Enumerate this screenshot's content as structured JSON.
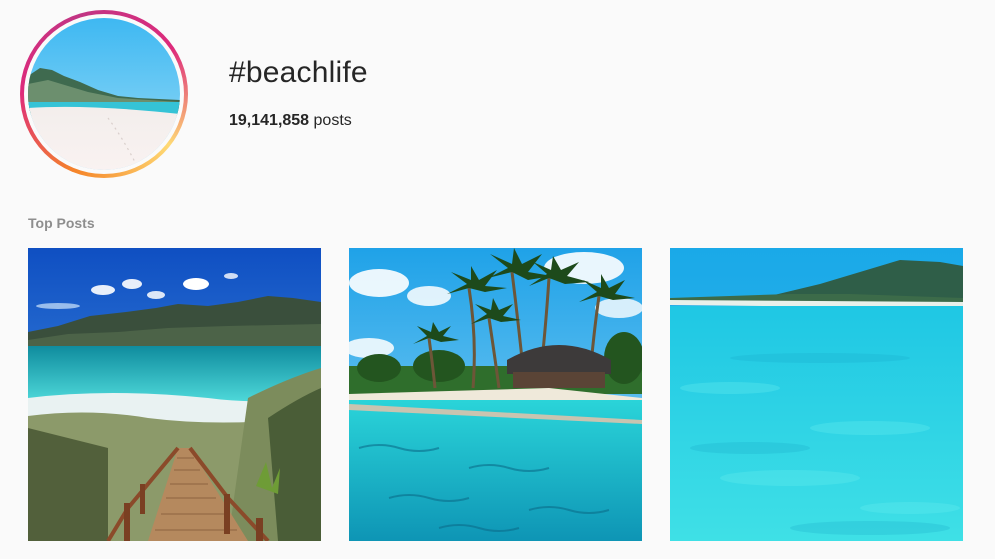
{
  "hashtag": {
    "title": "#beachlife",
    "post_count": "19,141,858",
    "post_count_suffix": " posts"
  },
  "sections": {
    "top_posts_label": "Top Posts"
  },
  "colors": {
    "text": "#262626",
    "muted": "#8e8e8e",
    "background": "#fafafa"
  }
}
